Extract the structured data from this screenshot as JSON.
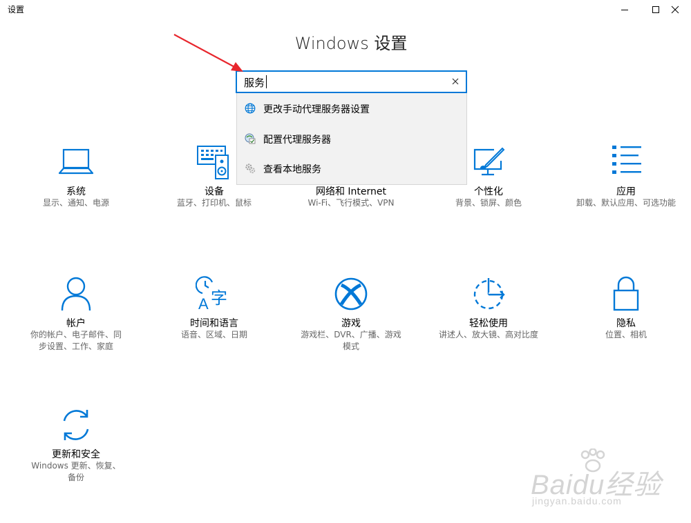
{
  "window": {
    "title": "设置",
    "minimize": "minimize",
    "maximize": "maximize",
    "close": "close"
  },
  "heading": "Windows 设置",
  "search": {
    "value": "服务",
    "suggestions": [
      {
        "label": "更改手动代理服务器设置",
        "icon": "globe-icon"
      },
      {
        "label": "配置代理服务器",
        "icon": "network-settings-icon"
      },
      {
        "label": "查看本地服务",
        "icon": "services-gear-icon"
      }
    ]
  },
  "tiles": [
    {
      "name": "系统",
      "desc": "显示、通知、电源",
      "icon": "laptop-icon"
    },
    {
      "name": "设备",
      "desc": "蓝牙、打印机、鼠标",
      "icon": "keyboard-speaker-icon"
    },
    {
      "name": "网络和 Internet",
      "desc": "Wi-Fi、飞行模式、VPN",
      "icon": "globe-network-icon"
    },
    {
      "name": "个性化",
      "desc": "背景、锁屏、颜色",
      "icon": "paint-brush-icon"
    },
    {
      "name": "应用",
      "desc": "卸载、默认应用、可选功能",
      "icon": "apps-list-icon"
    },
    {
      "name": "帐户",
      "desc": "你的帐户、电子邮件、同步设置、工作、家庭",
      "icon": "person-icon"
    },
    {
      "name": "时间和语言",
      "desc": "语音、区域、日期",
      "icon": "time-language-icon"
    },
    {
      "name": "游戏",
      "desc": "游戏栏、DVR、广播、游戏模式",
      "icon": "xbox-icon"
    },
    {
      "name": "轻松使用",
      "desc": "讲述人、放大镜、高对比度",
      "icon": "ease-of-access-icon"
    },
    {
      "name": "隐私",
      "desc": "位置、相机",
      "icon": "lock-icon"
    },
    {
      "name": "更新和安全",
      "desc": "Windows 更新、恢复、备份",
      "icon": "sync-icon"
    }
  ],
  "watermark": {
    "logo": "Baidu经验",
    "url": "jingyan.baidu.com"
  },
  "colors": {
    "accent": "#0078d7",
    "annotation_arrow": "#e8262d"
  }
}
